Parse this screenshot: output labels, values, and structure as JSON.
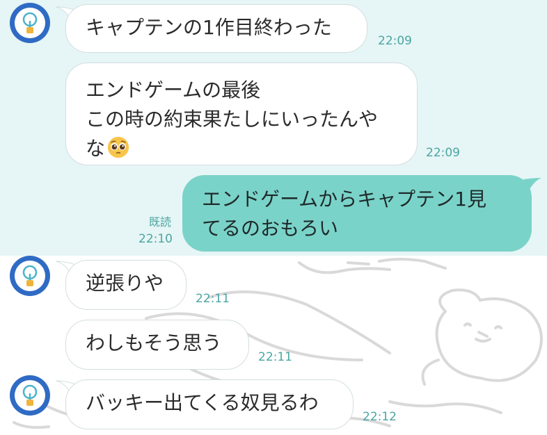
{
  "chat": {
    "messages": [
      {
        "text": "キャプテンの1作目終わった",
        "time": "22:09"
      },
      {
        "line1": "エンドゲームの最後",
        "line2": "この時の約束果たしにいったんや",
        "line3": "な",
        "time": "22:09"
      },
      {
        "line1": "エンドゲームからキャプテン1見",
        "line2": "てるのおもろい",
        "read": "既読",
        "time": "22:10"
      },
      {
        "text": "逆張りや",
        "time": "22:11"
      },
      {
        "text": "わしもそう思う",
        "time": "22:11"
      },
      {
        "text": "バッキー出てくる奴見るわ",
        "time": "22:12"
      }
    ],
    "icons": {
      "avatar": "lightbulb-icon",
      "emoji": "pleading-face-emoji"
    },
    "colors": {
      "top_background": "#e6f5f5",
      "sent_bubble": "#7ad3c9",
      "received_bubble": "#ffffff",
      "avatar": "#2f6bc4",
      "timestamp": "#4aa6a2"
    }
  }
}
